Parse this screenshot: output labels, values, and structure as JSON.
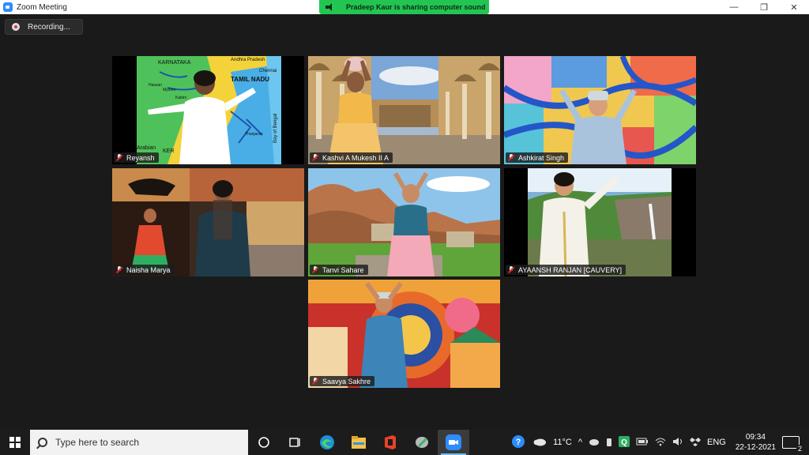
{
  "window": {
    "title": "Zoom Meeting",
    "controls": {
      "minimize": "—",
      "restore": "❐",
      "close": "✕"
    }
  },
  "sharing_banner": "Pradeep Kaur is sharing computer sound",
  "recording_label": "Recording...",
  "participants": [
    {
      "name": "Reyansh",
      "background": "map of South India",
      "map_labels": [
        "KARNATAKA",
        "Andhra Pradesh",
        "TAMIL NADU",
        "Chennai",
        "Hassan",
        "Mysore",
        "Kabini",
        "Thanjavur",
        "Bay of Bengal",
        "Arabian",
        "KER"
      ]
    },
    {
      "name": "Kashvi A Mukesh II A",
      "background": "palace courtyard"
    },
    {
      "name": "Ashkirat Singh",
      "background": "colourful collage"
    },
    {
      "name": "Naisha Marya",
      "background": "dance collage"
    },
    {
      "name": "Tanvi Sahare",
      "background": "rocky ruins"
    },
    {
      "name": "AYAANSH RANJAN [CAUVERY]",
      "background": "river and rocks"
    },
    {
      "name": "Saavya Sakhre",
      "background": "folk art"
    }
  ],
  "taskbar": {
    "search_placeholder": "Type here to search",
    "weather": "11°C",
    "language": "ENG",
    "time": "09:34",
    "date": "22-12-2021",
    "notifications": "2",
    "icons": [
      "task-view-icon",
      "edge-icon",
      "file-explorer-icon",
      "office-icon",
      "photos-icon",
      "zoom-icon"
    ]
  }
}
